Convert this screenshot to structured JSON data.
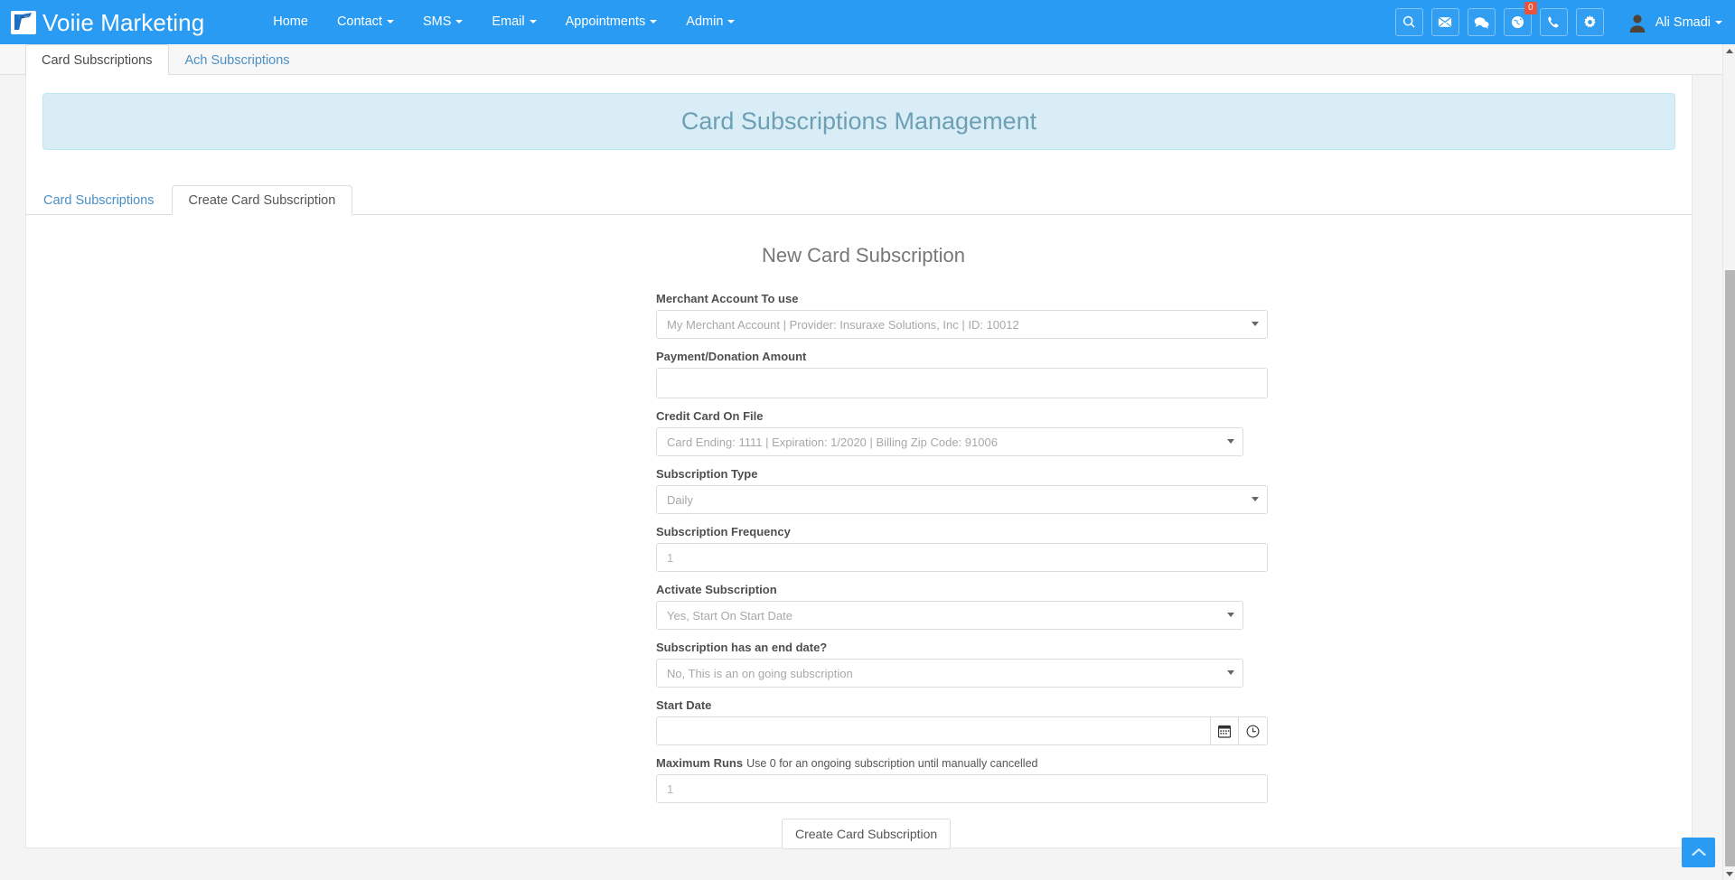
{
  "navbar": {
    "brand": "Voiie Marketing",
    "logo_icon": "voiie-logo-icon",
    "links": [
      {
        "label": "Home",
        "has_caret": false
      },
      {
        "label": "Contact",
        "has_caret": true
      },
      {
        "label": "SMS",
        "has_caret": true
      },
      {
        "label": "Email",
        "has_caret": true
      },
      {
        "label": "Appointments",
        "has_caret": true
      },
      {
        "label": "Admin",
        "has_caret": true
      }
    ],
    "icons": [
      {
        "name": "search-icon"
      },
      {
        "name": "envelope-icon"
      },
      {
        "name": "comments-icon"
      },
      {
        "name": "notifications-icon",
        "badge": "0"
      },
      {
        "name": "phone-icon"
      },
      {
        "name": "gear-icon"
      }
    ],
    "user": {
      "name": "Ali Smadi",
      "avatar_icon": "user-avatar-icon"
    },
    "accent_color": "#2a9bf2",
    "badge_color": "#e8533b"
  },
  "outer_tabs": [
    {
      "label": "Card Subscriptions",
      "active": true
    },
    {
      "label": "Ach Subscriptions",
      "active": false
    }
  ],
  "banner": {
    "title": "Card Subscriptions Management",
    "background": "#d9edf7",
    "border": "#bce8f1",
    "text_color": "#6d9fb5"
  },
  "inner_tabs": [
    {
      "label": "Card Subscriptions",
      "active": false
    },
    {
      "label": "Create Card Subscription",
      "active": true
    }
  ],
  "form": {
    "title": "New Card Subscription",
    "fields": [
      {
        "label": "Merchant Account To use",
        "type": "select",
        "value": "My Merchant Account | Provider: Insuraxe Solutions, Inc | ID: 10012"
      },
      {
        "label": "Payment/Donation Amount",
        "type": "input",
        "value": "",
        "placeholder": ""
      },
      {
        "label": "Credit Card On File",
        "type": "select",
        "value": "Card Ending: 1111 | Expiration: 1/2020 | Billing Zip Code: 91006"
      },
      {
        "label": "Subscription Type",
        "type": "select",
        "value": "Daily"
      },
      {
        "label": "Subscription Frequency",
        "type": "input",
        "value": "",
        "placeholder": "1"
      },
      {
        "label": "Activate Subscription",
        "type": "select",
        "value": "Yes, Start On Start Date"
      },
      {
        "label": "Subscription has an end date?",
        "type": "select",
        "value": "No, This is an on going subscription"
      },
      {
        "label": "Start Date",
        "type": "datetime",
        "value": "",
        "placeholder": "",
        "calendar_icon": "calendar-icon",
        "clock_icon": "clock-icon"
      },
      {
        "label": "Maximum Runs",
        "hint": "Use 0 for an ongoing subscription until manually cancelled",
        "type": "input",
        "value": "",
        "placeholder": "1"
      }
    ],
    "submit_label": "Create Card Subscription"
  },
  "scroll_top": {
    "icon": "chevron-up-icon"
  }
}
